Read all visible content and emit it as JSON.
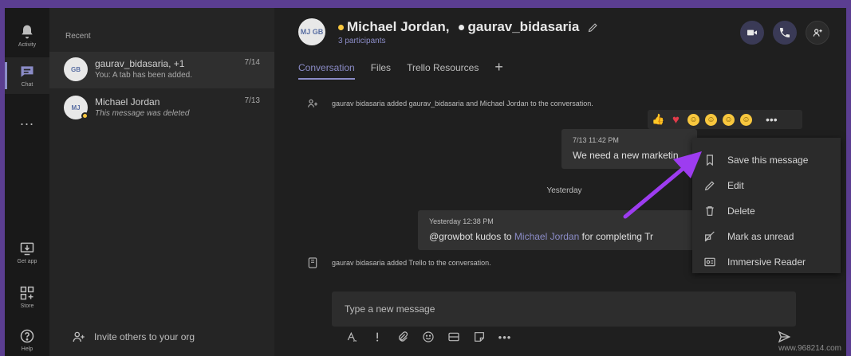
{
  "rail": {
    "items": [
      {
        "label": "Activity",
        "icon": "bell-icon"
      },
      {
        "label": "Chat",
        "icon": "chat-icon"
      },
      {
        "label": "...",
        "icon": "more-icon"
      },
      {
        "label": "Get app",
        "icon": "download-icon"
      },
      {
        "label": "Store",
        "icon": "store-icon"
      },
      {
        "label": "Help",
        "icon": "help-icon"
      }
    ]
  },
  "chat_list": {
    "heading": "Recent",
    "chats": [
      {
        "name": "gaurav_bidasaria, +1",
        "date": "7/14",
        "preview": "You: A tab has been added.",
        "avatar": "GB"
      },
      {
        "name": "Michael Jordan",
        "date": "7/13",
        "preview": "This message was deleted",
        "avatar": "MJ"
      }
    ],
    "invite_label": "Invite others to your org"
  },
  "header": {
    "avatar": "MJ GB",
    "name1": "Michael Jordan,",
    "name2": "gaurav_bidasaria",
    "participants": "3 participants",
    "tabs": [
      "Conversation",
      "Files",
      "Trello Resources"
    ],
    "add_tab": "+"
  },
  "conversation": {
    "system1": "gaurav bidasaria added gaurav_bidasaria and Michael Jordan to the conversation.",
    "msg1_meta": "7/13 11:42 PM",
    "msg1_text": "We need a new marketin",
    "divider": "Yesterday",
    "msg2_meta": "Yesterday 12:38 PM",
    "msg2_prefix": "@growbot kudos to ",
    "msg2_mention": "Michael Jordan",
    "msg2_suffix": " for completing Tr",
    "system2": "gaurav bidasaria added Trello to the conversation."
  },
  "context_menu": {
    "items": [
      {
        "label": "Save this message",
        "icon": "bookmark-icon"
      },
      {
        "label": "Edit",
        "icon": "pencil-icon"
      },
      {
        "label": "Delete",
        "icon": "trash-icon"
      },
      {
        "label": "Mark as unread",
        "icon": "unread-icon"
      },
      {
        "label": "Immersive Reader",
        "icon": "reader-icon"
      }
    ]
  },
  "composer": {
    "placeholder": "Type a new message"
  },
  "watermark": "www.968214.com",
  "colors": {
    "accent": "#8b8cc7",
    "frame": "#5b3e91",
    "arrow": "#9d3cf0",
    "away": "#f8c73e"
  }
}
